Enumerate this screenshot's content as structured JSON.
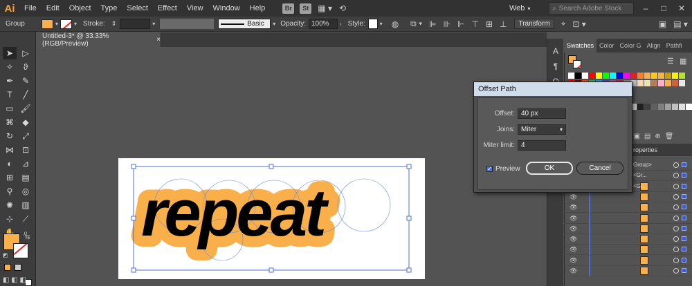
{
  "app": {
    "logo": "Ai"
  },
  "menu": [
    "File",
    "Edit",
    "Object",
    "Type",
    "Select",
    "Effect",
    "View",
    "Window",
    "Help"
  ],
  "bridge_icons": [
    "Br",
    "St"
  ],
  "workspace": "Web",
  "search_placeholder": "Search Adobe Stock",
  "control": {
    "selection": "Group",
    "stroke_label": "Stroke:",
    "brush": "Basic",
    "opacity_label": "Opacity:",
    "opacity_value": "100%",
    "style_label": "Style:",
    "transform": "Transform"
  },
  "document": {
    "tab": "Untitled-3* @ 33.33% (RGB/Preview)",
    "close": "×"
  },
  "artwork": {
    "text": "repeat",
    "fill": "#000000",
    "offset_color": "#f9b04a"
  },
  "panel": {
    "tabs": [
      "Swatches",
      "Color",
      "Color G",
      "Align",
      "Pathfi"
    ],
    "layers_tab": "roperties",
    "layer_rows": [
      "Group>",
      "<Gr...",
      "<Gr..."
    ]
  },
  "dialog": {
    "title": "Offset Path",
    "offset_label": "Offset:",
    "offset_value": "40 px",
    "joins_label": "Joins:",
    "joins_value": "Miter",
    "miter_label": "Miter limit:",
    "miter_value": "4",
    "preview_label": "Preview",
    "preview_checked": true,
    "ok": "OK",
    "cancel": "Cancel"
  },
  "colors": {
    "accent_orange": "#f9b04a",
    "selection_blue": "#4b6fd6"
  }
}
